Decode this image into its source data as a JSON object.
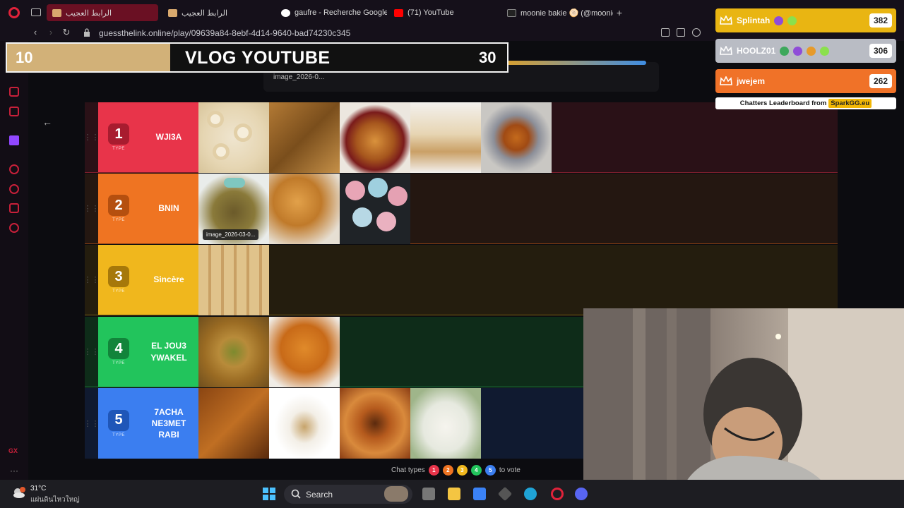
{
  "browser": {
    "tabs": [
      {
        "label": "الرابط العجيب",
        "active": true
      },
      {
        "label": "الرابط العجيب",
        "active": false
      },
      {
        "label": "gaufre - Recherche Google",
        "active": false
      },
      {
        "label": "(71) YouTube",
        "active": false
      },
      {
        "label": "moonie bakie 🫓 (@moonie",
        "active": false
      }
    ],
    "url": "guessthelink.online/play/09639a84-8ebf-4d14-9640-bad74230c345"
  },
  "search_hint": "image_2026-0...",
  "tiers": [
    {
      "rank": "1",
      "sub": "TYPE",
      "label": "WJI3A",
      "color": "#e8344a",
      "badge": "#a81c2f",
      "row_bg": "#2a1117",
      "border": "#7a1e2c"
    },
    {
      "rank": "2",
      "sub": "TYPE",
      "label": "BNIN",
      "color": "#ef7422",
      "badge": "#b54f0f",
      "row_bg": "#241711",
      "border": "#8a3f15"
    },
    {
      "rank": "3",
      "sub": "TYPE",
      "label": "Sincère",
      "color": "#f0b71d",
      "badge": "#a6780a",
      "row_bg": "#241d0e",
      "border": "#7e6212"
    },
    {
      "rank": "4",
      "sub": "TYPE",
      "label": "EL JOU3 YWAKEL",
      "color": "#22c45c",
      "badge": "#12843a",
      "row_bg": "#0e2c19",
      "border": "#1f8a44"
    },
    {
      "rank": "5",
      "sub": "TYPE",
      "label": "7ACHA NE3MET RABI",
      "color": "#3b7ef0",
      "badge": "#1f56b8",
      "row_bg": "#101a30",
      "border": "#24488a"
    }
  ],
  "image_tooltip": "image_2026-03-0...",
  "vote_bar": {
    "left_count": "10",
    "title": "VLOG YOUTUBE",
    "right_count": "30"
  },
  "leaderboard": {
    "entries": [
      {
        "name": "Splintah",
        "score": "382",
        "bg": "#e9b512"
      },
      {
        "name": "HOOLZ01",
        "score": "306",
        "bg": "#b9bcc4"
      },
      {
        "name": "jwejem",
        "score": "262",
        "bg": "#f07228"
      }
    ],
    "footer": "Chatters Leaderboard from",
    "footer_tag": "SparkGG.eu"
  },
  "chat_types": {
    "prefix": "Chat types",
    "suffix": "to vote",
    "numbers": [
      "1",
      "2",
      "3",
      "4",
      "5"
    ],
    "colors": [
      "#e8344a",
      "#ef7422",
      "#f0b71d",
      "#22c45c",
      "#3b7ef0"
    ]
  },
  "taskbar": {
    "temp": "31°C",
    "location": "แผ่นดินไหวใหญ่",
    "search": "Search"
  }
}
